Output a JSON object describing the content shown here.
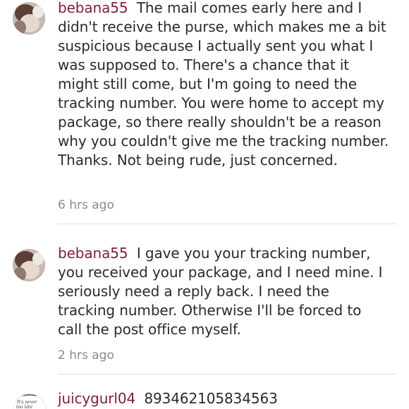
{
  "comments": [
    {
      "username": "bebana55",
      "text": "The mail comes early here and I didn't receive the purse, which makes me a bit suspicious because I actually sent you what I was supposed to. There's a chance that it might still come, but I'm going to need the tracking number. You were home to accept my package, so there really shouldn't be a reason why you couldn't give me the tracking number. Thanks. Not being rude, just concerned.",
      "time": "6 hrs ago"
    },
    {
      "username": "bebana55",
      "text": "I gave you your tracking number, you received your package, and I need mine. I seriously need a reply back. I need the tracking number. Otherwise I'll be forced to call the post office myself.",
      "time": "2 hrs ago"
    },
    {
      "username": "juicygurl04",
      "text": "893462105834563",
      "avatar_text": "It's never too late"
    }
  ]
}
